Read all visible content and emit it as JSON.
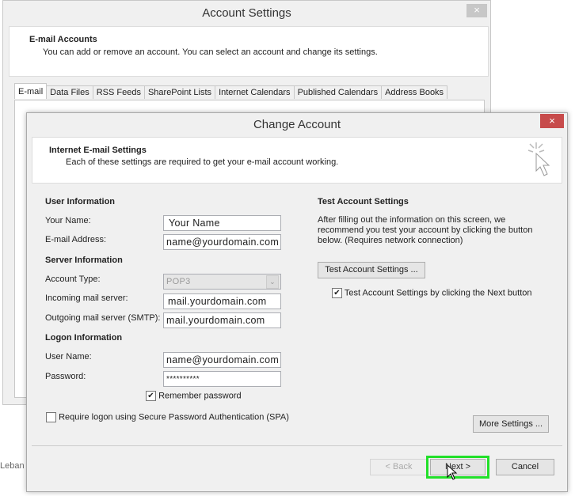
{
  "account_settings": {
    "title": "Account Settings",
    "close": "×",
    "header_title": "E-mail Accounts",
    "header_desc": "You can add or remove an account. You can select an account and change its settings.",
    "tabs": [
      "E-mail",
      "Data Files",
      "RSS Feeds",
      "SharePoint Lists",
      "Internet Calendars",
      "Published Calendars",
      "Address Books"
    ],
    "active_tab": "E-mail"
  },
  "background_text": {
    "fragment": "Leban"
  },
  "change_account": {
    "title": "Change Account",
    "close": "×",
    "header_title": "Internet E-mail Settings",
    "header_desc": "Each of these settings are required to get your e-mail account working.",
    "header_icon": "cursor-click-icon",
    "user_info": {
      "heading": "User Information",
      "your_name_label": "Your Name:",
      "your_name": "Your Name",
      "email_label": "E-mail Address:",
      "email": "name@yourdomain.com"
    },
    "server_info": {
      "heading": "Server Information",
      "account_type_label": "Account Type:",
      "account_type": "POP3",
      "incoming_label": "Incoming mail server:",
      "incoming": "mail.yourdomain.com",
      "outgoing_label": "Outgoing mail server (SMTP):",
      "outgoing": "mail.yourdomain.com"
    },
    "logon_info": {
      "heading": "Logon Information",
      "user_name_label": "User Name:",
      "user_name": "name@yourdomain.com",
      "password_label": "Password:",
      "password": "**********",
      "remember_label": "Remember password",
      "remember_checked": true,
      "spa_label": "Require logon using Secure Password Authentication (SPA)",
      "spa_checked": false
    },
    "test": {
      "heading": "Test Account Settings",
      "desc": "After filling out the information on this screen, we recommend you test your account by clicking the button below. (Requires network connection)",
      "button": "Test Account Settings ...",
      "auto_label": "Test Account Settings by clicking the Next button",
      "auto_checked": true
    },
    "more_settings": "More Settings ...",
    "back": "< Back",
    "next": "Next >",
    "cancel": "Cancel",
    "highlight_color": "#22e02a"
  }
}
